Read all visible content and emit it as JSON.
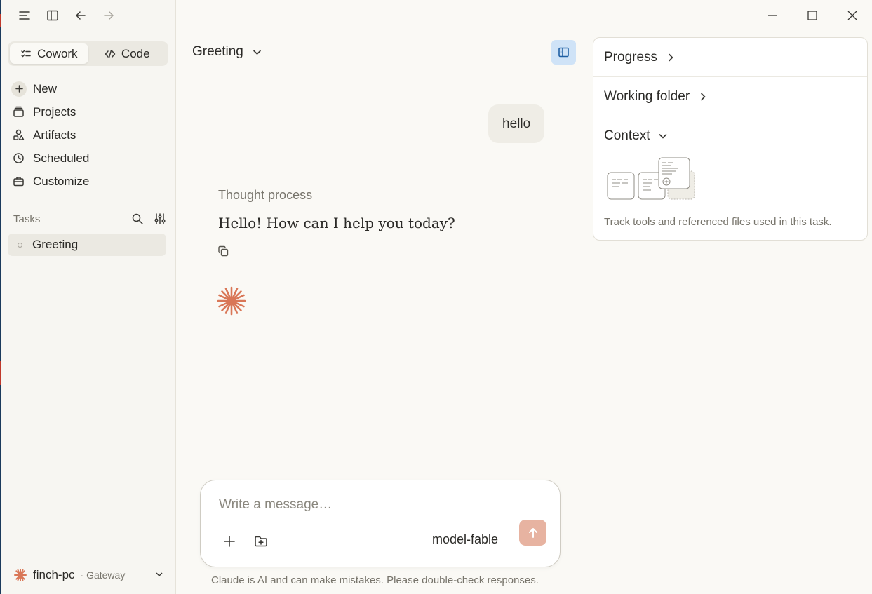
{
  "nav_controls": {
    "menu_icon": "menu-icon",
    "sidebar_icon": "sidebar-toggle-icon",
    "back_icon": "arrow-left-icon",
    "forward_icon": "arrow-right-icon"
  },
  "mode_switch": {
    "cowork_label": "Cowork",
    "code_label": "Code",
    "active": "Cowork"
  },
  "nav": {
    "items": [
      {
        "label": "New",
        "icon": "plus-icon"
      },
      {
        "label": "Projects",
        "icon": "projects-icon"
      },
      {
        "label": "Artifacts",
        "icon": "artifacts-icon"
      },
      {
        "label": "Scheduled",
        "icon": "clock-icon"
      },
      {
        "label": "Customize",
        "icon": "briefcase-icon"
      }
    ]
  },
  "tasks": {
    "title": "Tasks",
    "items": [
      {
        "label": "Greeting"
      }
    ]
  },
  "footer": {
    "name": "finch-pc",
    "sub": "· Gateway"
  },
  "chat": {
    "title": "Greeting",
    "user_message": "hello",
    "thought_label": "Thought process",
    "assistant_reply": "Hello! How can I help you today?"
  },
  "composer": {
    "placeholder": "Write a message…",
    "model": "model-fable",
    "disclaimer": "Claude is AI and can make mistakes. Please double-check responses."
  },
  "side_panel": {
    "progress_label": "Progress",
    "folder_label": "Working folder",
    "context_label": "Context",
    "context_caption": "Track tools and referenced files used in this task."
  },
  "colors": {
    "accent": "#d97757",
    "panel_toggle_bg": "#cfe3f7",
    "send_button": "#e7b3a1"
  }
}
